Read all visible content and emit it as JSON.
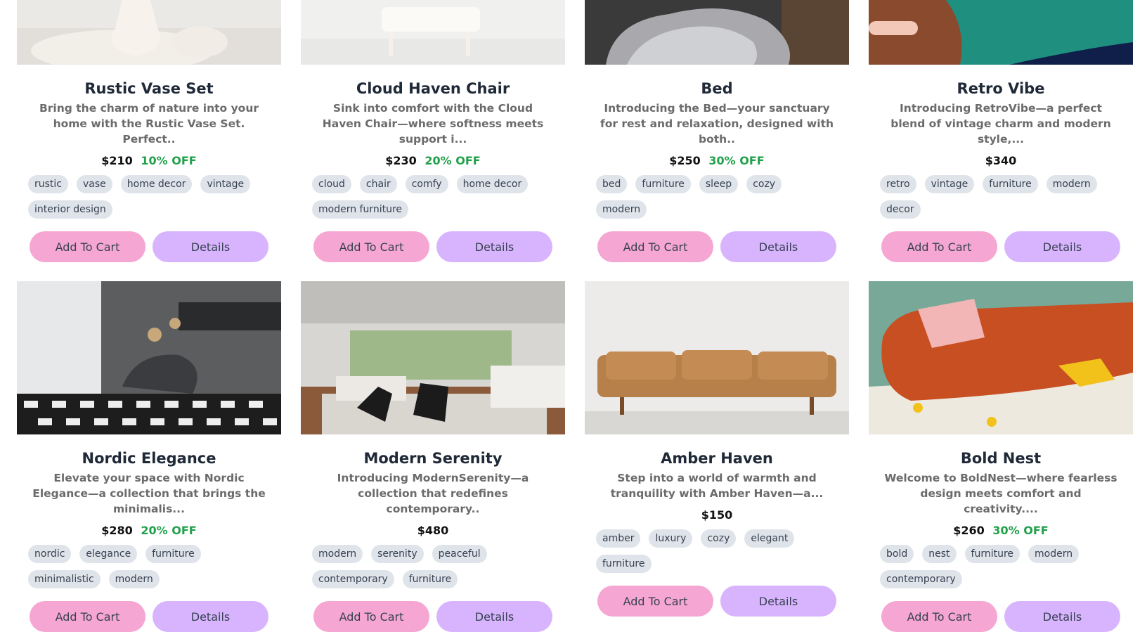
{
  "buttons": {
    "add_to_cart": "Add To Cart",
    "details": "Details"
  },
  "products": [
    {
      "title": "Rustic Vase Set",
      "desc": "Bring the charm of nature into your home with the Rustic Vase Set. Perfect..",
      "price": "$210",
      "discount": "10% OFF",
      "tags": [
        "rustic",
        "vase",
        "home decor",
        "vintage",
        "interior design"
      ],
      "image": "vase-image"
    },
    {
      "title": "Cloud Haven Chair",
      "desc": "Sink into comfort with the Cloud Haven Chair—where softness meets support i...",
      "price": "$230",
      "discount": "20% OFF",
      "tags": [
        "cloud",
        "chair",
        "comfy",
        "home decor",
        "modern furniture"
      ],
      "image": "chair-image"
    },
    {
      "title": "Bed",
      "desc": "Introducing the Bed—your sanctuary for rest and relaxation, designed with both..",
      "price": "$250",
      "discount": "30% OFF",
      "tags": [
        "bed",
        "furniture",
        "sleep",
        "cozy",
        "modern"
      ],
      "image": "bed-image"
    },
    {
      "title": "Retro Vibe",
      "desc": "Introducing RetroVibe—a perfect blend of vintage charm and modern style,...",
      "price": "$340",
      "discount": "",
      "tags": [
        "retro",
        "vintage",
        "furniture",
        "modern",
        "decor"
      ],
      "image": "retro-sofa-image"
    },
    {
      "title": "Nordic Elegance",
      "desc": "Elevate your space with Nordic Elegance—a collection that brings the minimalis...",
      "price": "$280",
      "discount": "20% OFF",
      "tags": [
        "nordic",
        "elegance",
        "furniture",
        "minimalistic",
        "modern"
      ],
      "image": "nordic-room-image"
    },
    {
      "title": "Modern Serenity",
      "desc": "Introducing ModernSerenity—a collection that redefines contemporary..",
      "price": "$480",
      "discount": "",
      "tags": [
        "modern",
        "serenity",
        "peaceful",
        "contemporary",
        "furniture"
      ],
      "image": "living-room-image"
    },
    {
      "title": "Amber Haven",
      "desc": "Step into a world of warmth and tranquility with Amber Haven—a...",
      "price": "$150",
      "discount": "",
      "tags": [
        "amber",
        "luxury",
        "cozy",
        "elegant",
        "furniture"
      ],
      "image": "leather-sofa-image"
    },
    {
      "title": "Bold Nest",
      "desc": "Welcome to BoldNest—where fearless design meets comfort and creativity....",
      "price": "$260",
      "discount": "30% OFF",
      "tags": [
        "bold",
        "nest",
        "furniture",
        "modern",
        "contemporary"
      ],
      "image": "orange-sofa-image"
    }
  ]
}
